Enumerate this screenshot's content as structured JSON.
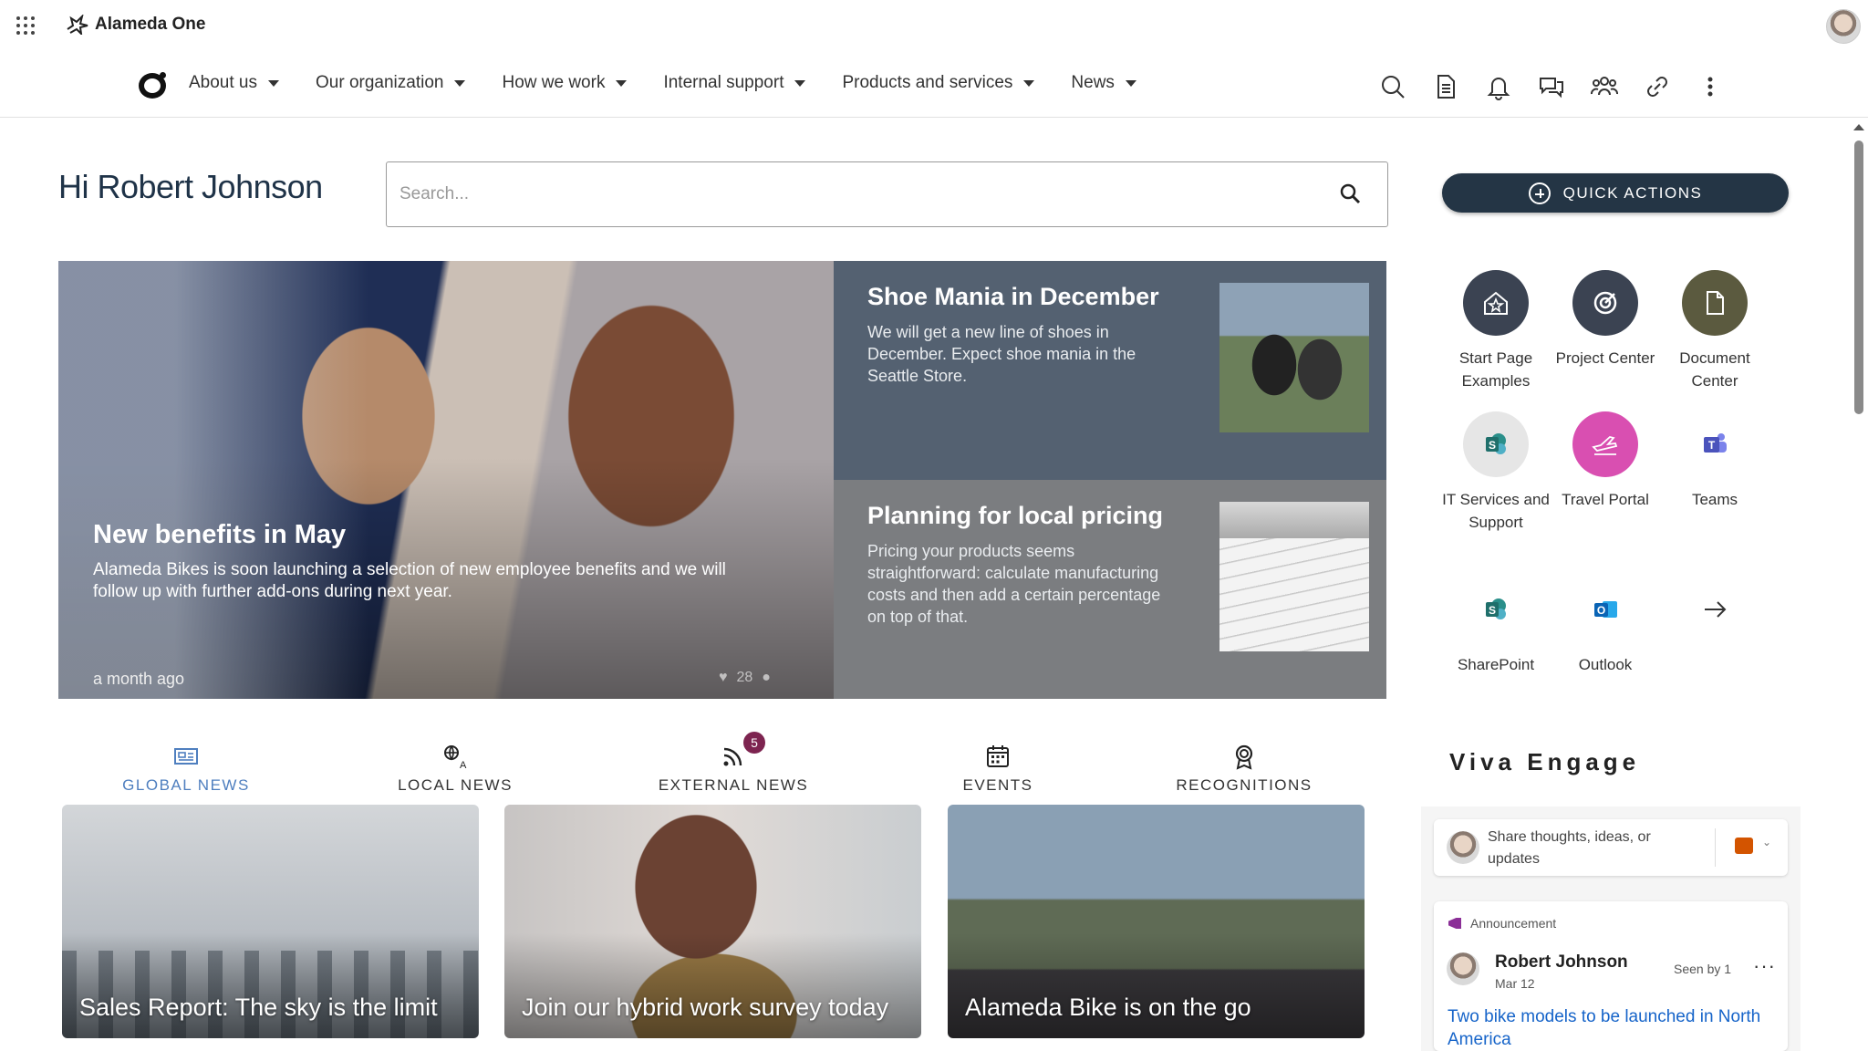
{
  "topbar": {
    "brand": "Alameda One"
  },
  "nav": {
    "items": [
      "About us",
      "Our organization",
      "How we work",
      "Internal support",
      "Products and services",
      "News"
    ],
    "icons": [
      "search-icon",
      "document-icon",
      "bell-icon",
      "chat-icon",
      "people-icon",
      "link-icon",
      "more-icon"
    ]
  },
  "greeting": "Hi Robert Johnson",
  "search": {
    "placeholder": "Search..."
  },
  "hero": {
    "main": {
      "title": "New benefits in May",
      "description": "Alameda Bikes is soon launching a selection of new employee benefits and we will follow up with further add-ons during next year.",
      "time": "a month ago",
      "likes": "28"
    },
    "side": [
      {
        "title": "Shoe Mania in December",
        "description": "We will get a new line of shoes in December. Expect shoe mania in the Seattle Store."
      },
      {
        "title": "Planning for local pricing",
        "description": "Pricing your products seems straightforward: calculate manufacturing costs and then add a certain percentage on top of that."
      }
    ]
  },
  "quick_actions": {
    "label": "QUICK ACTIONS",
    "apps": [
      {
        "label": "Start Page Examples",
        "icon": "home-star-icon",
        "color": "#3b4352"
      },
      {
        "label": "Project Center",
        "icon": "target-icon",
        "color": "#3b4352"
      },
      {
        "label": "Document Center",
        "icon": "document-icon",
        "color": "#5b5a3f"
      },
      {
        "label": "IT Services and Support",
        "icon": "sharepoint-icon",
        "color": "#e6e6e6"
      },
      {
        "label": "Travel Portal",
        "icon": "plane-icon",
        "color": "#d94fb1"
      },
      {
        "label": "Teams",
        "icon": "teams-icon",
        "color": "#ffffff"
      },
      {
        "label": "SharePoint",
        "icon": "sharepoint-icon",
        "color": "#ffffff"
      },
      {
        "label": "Outlook",
        "icon": "outlook-icon",
        "color": "#ffffff"
      },
      {
        "label": "",
        "icon": "arrow-right-icon",
        "color": "#ffffff"
      }
    ]
  },
  "tabs": [
    {
      "label": "GLOBAL NEWS",
      "icon": "newspaper-icon",
      "active": true
    },
    {
      "label": "LOCAL NEWS",
      "icon": "globe-translate-icon",
      "active": false
    },
    {
      "label": "EXTERNAL NEWS",
      "icon": "rss-icon",
      "active": false,
      "badge": "5"
    },
    {
      "label": "EVENTS",
      "icon": "calendar-icon",
      "active": false
    },
    {
      "label": "RECOGNITIONS",
      "icon": "award-icon",
      "active": false
    }
  ],
  "cards": [
    {
      "title": "Sales Report: The sky is the limit"
    },
    {
      "title": "Join our hybrid work survey today"
    },
    {
      "title": "Alameda Bike is on the go"
    }
  ],
  "viva": {
    "title": "Viva Engage",
    "compose_placeholder": "Share thoughts, ideas, or updates",
    "post": {
      "tag": "Announcement",
      "author": "Robert Johnson",
      "date": "Mar 12",
      "seen": "Seen by 1",
      "link": "Two bike models to be launched in North America"
    }
  }
}
